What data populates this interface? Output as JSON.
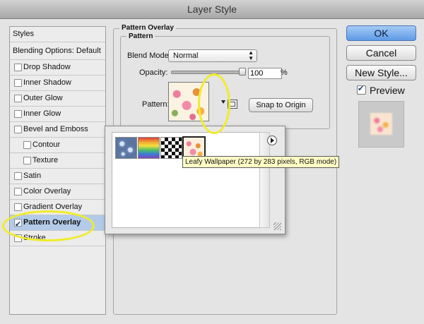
{
  "window": {
    "title": "Layer Style"
  },
  "styles_panel": {
    "header": "Styles",
    "blending": "Blending Options: Default",
    "items": [
      {
        "label": "Drop Shadow",
        "checked": false,
        "indent": false
      },
      {
        "label": "Inner Shadow",
        "checked": false,
        "indent": false
      },
      {
        "label": "Outer Glow",
        "checked": false,
        "indent": false
      },
      {
        "label": "Inner Glow",
        "checked": false,
        "indent": false
      },
      {
        "label": "Bevel and Emboss",
        "checked": false,
        "indent": false
      },
      {
        "label": "Contour",
        "checked": false,
        "indent": true
      },
      {
        "label": "Texture",
        "checked": false,
        "indent": true
      },
      {
        "label": "Satin",
        "checked": false,
        "indent": false
      },
      {
        "label": "Color Overlay",
        "checked": false,
        "indent": false
      },
      {
        "label": "Gradient Overlay",
        "checked": false,
        "indent": false
      },
      {
        "label": "Pattern Overlay",
        "checked": true,
        "indent": false,
        "selected": true
      },
      {
        "label": "Stroke",
        "checked": false,
        "indent": false
      }
    ]
  },
  "pattern_overlay": {
    "group_title": "Pattern Overlay",
    "subgroup_title": "Pattern",
    "blend_mode_label": "Blend Mode:",
    "blend_mode_value": "Normal",
    "opacity_label": "Opacity:",
    "opacity_value": "100",
    "opacity_unit": "%",
    "opacity_level": 1.0,
    "pattern_label": "Pattern:",
    "snap_button": "Snap to Origin"
  },
  "pattern_picker": {
    "tiles": [
      {
        "name": "bubbles",
        "icon": "bubbles-pattern-icon"
      },
      {
        "name": "rainbow",
        "icon": "rainbow-pattern-icon"
      },
      {
        "name": "checker",
        "icon": "checkerboard-pattern-icon"
      },
      {
        "name": "leafy",
        "icon": "leafy-wallpaper-pattern-icon",
        "selected": true
      }
    ],
    "tooltip": "Leafy Wallpaper (272 by 283 pixels, RGB mode)"
  },
  "actions": {
    "ok": "OK",
    "cancel": "Cancel",
    "new_style": "New Style...",
    "preview_label": "Preview",
    "preview_checked": true
  },
  "colors": {
    "highlight": "#f0ec2c",
    "selection": "#b3cbe9",
    "ok_button": "#5f9ae6"
  }
}
